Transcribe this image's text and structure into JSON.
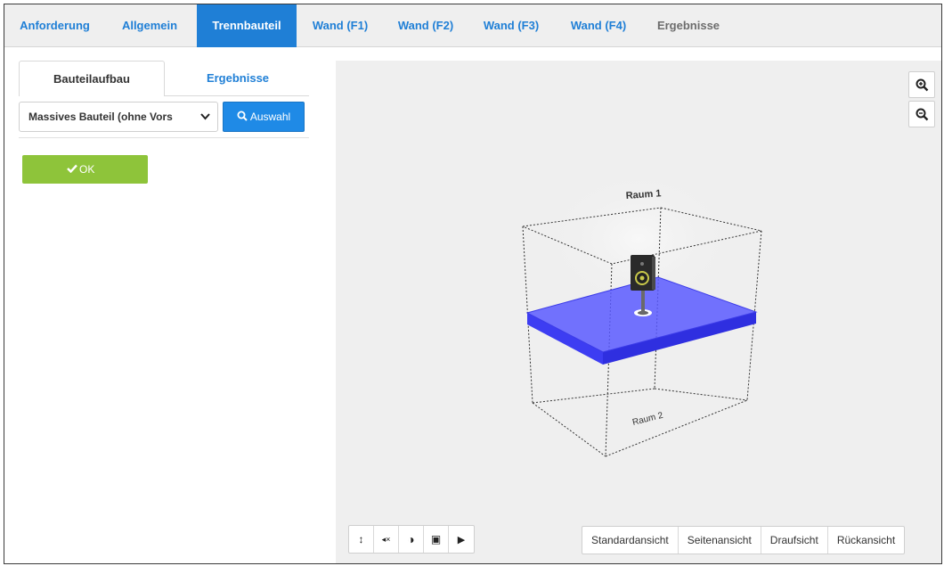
{
  "top_tabs": [
    {
      "label": "Anforderung",
      "state": "normal"
    },
    {
      "label": "Allgemein",
      "state": "normal"
    },
    {
      "label": "Trennbauteil",
      "state": "active"
    },
    {
      "label": "Wand (F1)",
      "state": "normal"
    },
    {
      "label": "Wand (F2)",
      "state": "normal"
    },
    {
      "label": "Wand (F3)",
      "state": "normal"
    },
    {
      "label": "Wand (F4)",
      "state": "normal"
    },
    {
      "label": "Ergebnisse",
      "state": "disabled"
    }
  ],
  "left_panel": {
    "subtabs": [
      {
        "label": "Bauteilaufbau",
        "active": true
      },
      {
        "label": "Ergebnisse",
        "active": false
      }
    ],
    "select": {
      "value": "Massives Bauteil (ohne Vors",
      "icon": "chevron-down-icon"
    },
    "auswahl_button": {
      "label": "Auswahl",
      "icon": "search-icon"
    },
    "ok_button": {
      "label": "OK",
      "icon": "check-icon"
    }
  },
  "viewer": {
    "zoom_in": {
      "icon": "zoom-in-icon"
    },
    "zoom_out": {
      "icon": "zoom-out-icon"
    },
    "scene": {
      "room_top_label": "Raum 1",
      "room_bottom_label": "Raum 2",
      "slab_color": "#4b4bff",
      "speaker_icon": "speaker-icon"
    },
    "tools": [
      {
        "icon": "vertical-arrows-icon",
        "glyph": "↕"
      },
      {
        "icon": "mute-icon",
        "glyph": "◂×"
      },
      {
        "icon": "contrast-icon",
        "glyph": "◑"
      },
      {
        "icon": "camera-icon",
        "glyph": "▣"
      },
      {
        "icon": "play-icon",
        "glyph": "▶"
      }
    ],
    "view_buttons": [
      "Standardansicht",
      "Seitenansicht",
      "Draufsicht",
      "Rückansicht"
    ]
  },
  "colors": {
    "accent": "#1f7fd6",
    "ok": "#8ec43a",
    "viewer_bg": "#efefef"
  }
}
